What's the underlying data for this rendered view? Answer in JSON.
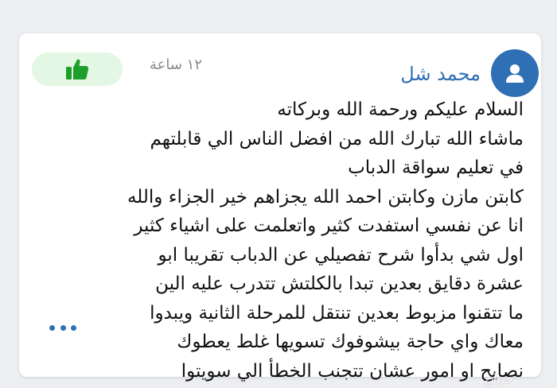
{
  "comment": {
    "author": "محمد شل",
    "time": "١٢ ساعة",
    "avatar_icon": "user-icon",
    "like_icon": "thumbs-up-icon",
    "more_icon": "more-dots-icon",
    "lines": [
      "السلام عليكم ورحمة الله وبركاته",
      "ماشاء الله تبارك الله من افضل الناس الي قابلتهم",
      "في تعليم سواقة الدباب",
      "كابتن مازن وكابتن احمد الله يجزاهم خير الجزاء والله",
      "انا عن نفسي استفدت كثير واتعلمت على اشياء كثير",
      "اول شي بدأوا  شرح تفصيلي عن الدباب تقريبا ابو",
      "عشرة دقايق بعدين تبدا بالكلتش تتدرب عليه الين",
      "ما تتقنوا مزبوط بعدين تنتقل للمرحلة الثانية ويبدوا",
      "معاك واي حاجة بيشوفوك تسويها غلط يعطوك",
      "نصايح او امور عشان تتجنب الخطأ الي سويتوا"
    ]
  },
  "watermark": "حراج",
  "colors": {
    "accent": "#2f6fb3",
    "like_bg": "#e4f6e4",
    "like_icon": "#1e9e2a",
    "text": "#111111",
    "muted": "#8a8a8a"
  }
}
